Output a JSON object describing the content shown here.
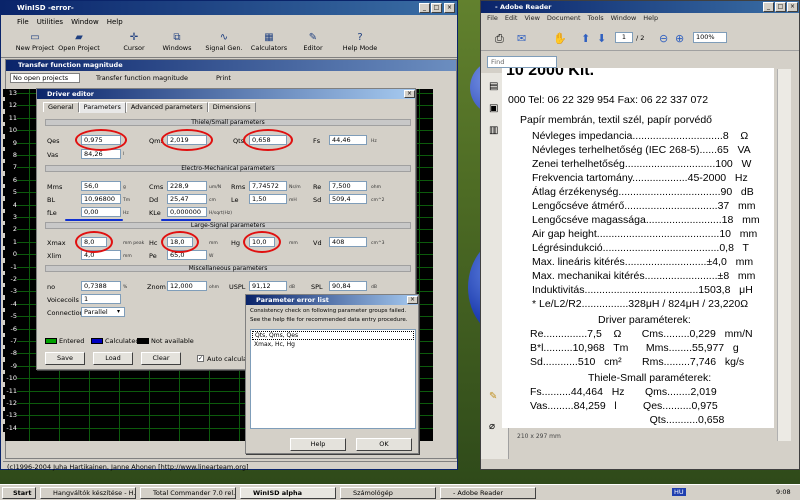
{
  "winisd": {
    "title": "WinISD -error-",
    "menu": [
      "File",
      "Utilities",
      "Window",
      "Help"
    ],
    "toolbar": [
      "New Project",
      "Open Project",
      "Cursor",
      "Windows",
      "Signal Gen.",
      "Calculators",
      "Editor",
      "Help Mode"
    ],
    "tf_title": "Transfer function magnitude",
    "tf_bar": [
      "No open projects",
      "Transfer function magnitude",
      "Print"
    ],
    "yticks": [
      "13",
      "12",
      "11",
      "10",
      "9",
      "8",
      "7",
      "6",
      "5",
      "4",
      "3",
      "2",
      "1",
      "0",
      "-1",
      "-2",
      "-3",
      "-4",
      "-5",
      "-6",
      "-7",
      "-8",
      "-9",
      "-10",
      "-11",
      "-12",
      "-13",
      "-14"
    ],
    "xticks": [
      "10",
      "20",
      "50"
    ],
    "status": "(c)1996-2004 Juha Hartikainen, Janne Ahonen [http://www.linearteam.org]"
  },
  "editor": {
    "title": "Driver editor",
    "tabs": [
      "General",
      "Parameters",
      "Advanced parameters",
      "Dimensions"
    ],
    "s1": "Thiele/Small parameters",
    "s2": "Electro-Mechanical parameters",
    "s3": "Large-Signal parameters",
    "s4": "Miscellaneous parameters",
    "qes": "0,975",
    "qms": "2,019",
    "qts": "0,658",
    "fs": "44,46",
    "vas": "84,26",
    "mms": "56,0",
    "cms": "228,9",
    "rms": "7,74572",
    "re": "7,500",
    "bl": "10,96800",
    "dd": "25,47",
    "le": "1,50",
    "sd": "509,4",
    "fle": "0,00",
    "kle": "0,000000",
    "xmax": "8,0",
    "hc": "18,0",
    "hg": "10,0",
    "vd": "408",
    "xlim": "4,0",
    "pe": "65,0",
    "no": "0,7388",
    "znom": "12,000",
    "uspl": "91,12",
    "spl": "90,84",
    "voicecoils": "1",
    "connection": "Parallel",
    "legend": [
      "Entered",
      "Calculated",
      "Not available"
    ],
    "legend_colors": [
      "#00a000",
      "#0000c0",
      "#000000"
    ],
    "buttons": [
      "Save",
      "Load",
      "Clear"
    ],
    "auto": "Auto calculate"
  },
  "errlist": {
    "title": "Parameter error list",
    "msg1": "Consistency check on following parameter groups failed.",
    "msg2": "See the help file for recommended data entry procedure.",
    "items": [
      "Qts, Qms, Qes",
      "Xmax, Hc, Hg"
    ],
    "help": "Help",
    "ok": "OK"
  },
  "adobe": {
    "title": "- Adobe Reader",
    "menu": [
      "File",
      "Edit",
      "View",
      "Document",
      "Tools",
      "Window",
      "Help"
    ],
    "page": "1",
    "pages": "/ 2",
    "zoom": "100%",
    "find": "Find",
    "size": "210 x 297 mm",
    "lines": [
      "10 2000 Kit.",
      "000 Tel: 06 22 329 954 Fax: 06 22 337 072",
      "Papír membrán, textil szél, papír porvédő",
      "Névleges impedancia...............................8    Ω",
      "Névleges terhelhetőség (IEC 268-5)......65   VA",
      "Zenei terhelhetőség...............................100   W",
      "Frekvencia tartomány...................45-2000   Hz",
      "Átlag érzékenység...................................90   dB",
      "Lengőcséve átmérő................................37   mm",
      "Lengőcséve magassága..........................18   mm",
      "Air gap height..........................................10   mm",
      "Légrésindukció........................................0,8   T",
      "Max. lineáris kitérés............................±4,0   mm",
      "Max. mechanikai kitérés.........................±8   mm",
      "Induktivitás.......................................1503,8   μH",
      "* Le/L2/R2................328μH / 824μH / 23,220Ω",
      "Driver paraméterek:",
      "Re...............7,5    Ω       Cms.........0,229   mm/N",
      "B*l..........10,968   Tm      Mms........55,977   g",
      "Sd............510   cm²       Rms.........7,746   kg/s",
      "Thiele-Small paraméterek:",
      "Fs..........44,464   Hz       Qms........2,019",
      "Vas.........84,259   l         Qes..........0,975",
      "                                         Qts...........0,658"
    ]
  },
  "taskbar": {
    "start": "Start",
    "items": [
      "Hangváltók készítése - H...",
      "Total Commander 7.0 rel...",
      "WinISD alpha",
      "Számológép",
      "- Adobe Reader"
    ],
    "clock": "9:08",
    "lang": "HU"
  }
}
